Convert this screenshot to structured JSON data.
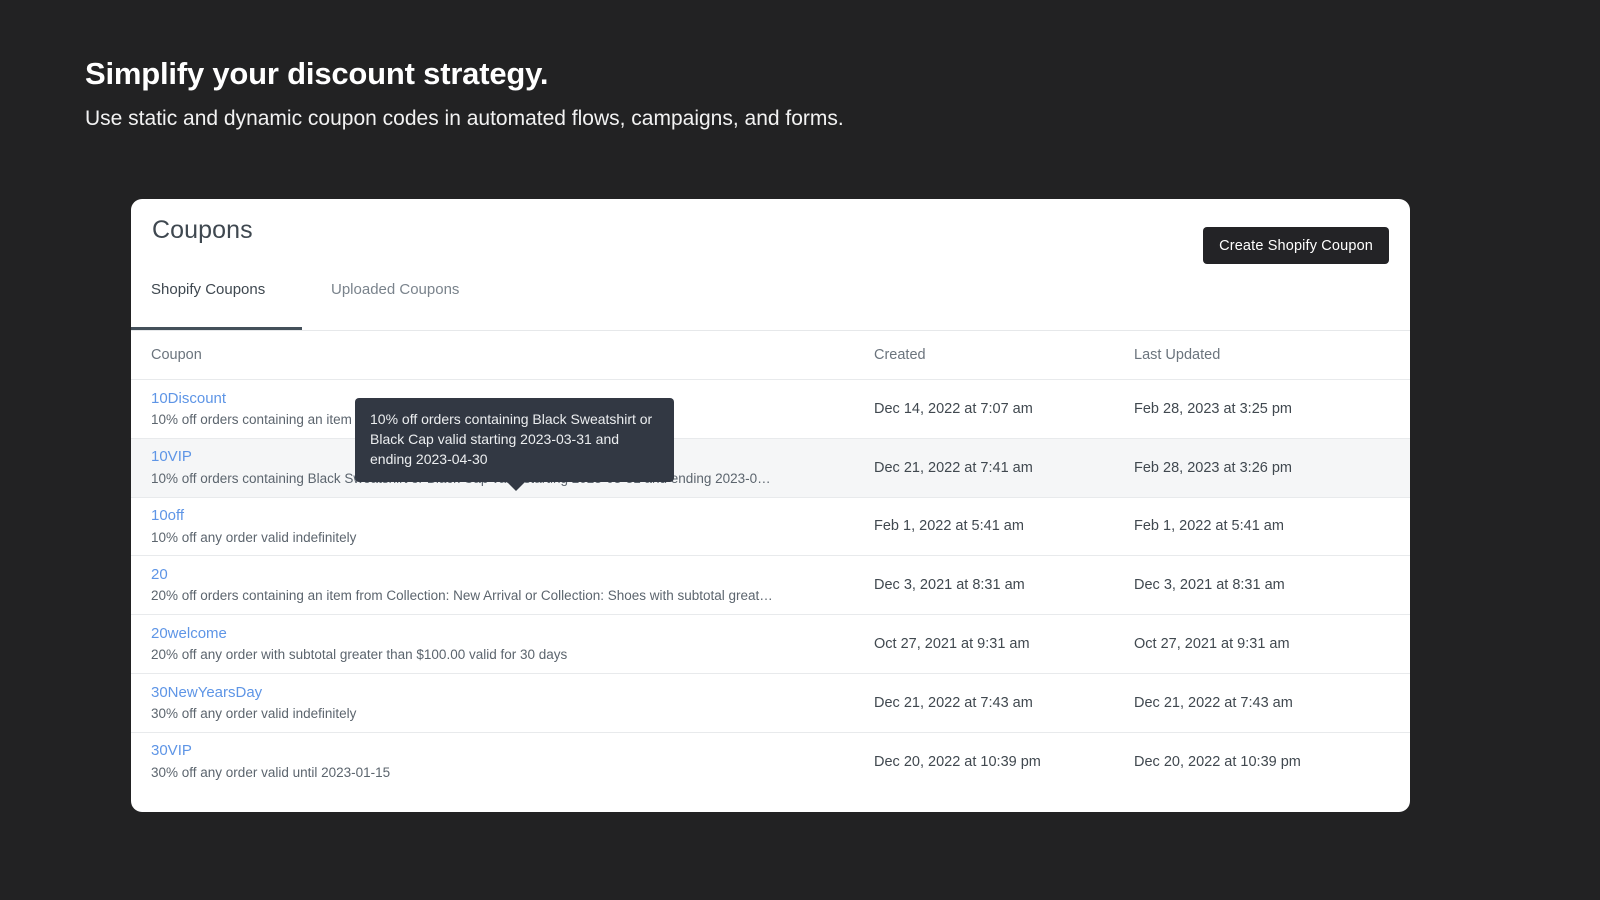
{
  "hero": {
    "title": "Simplify your discount strategy.",
    "subtitle": "Use static and dynamic coupon codes in automated flows, campaigns, and forms."
  },
  "card": {
    "title": "Coupons",
    "create_button_label": "Create Shopify Coupon",
    "tabs": [
      {
        "label": "Shopify Coupons",
        "active": true
      },
      {
        "label": "Uploaded Coupons",
        "active": false
      }
    ]
  },
  "table": {
    "columns": {
      "coupon": "Coupon",
      "created": "Created",
      "last_updated": "Last Updated"
    },
    "rows": [
      {
        "code": "10Discount",
        "description": "10% off orders containing an item from Collection: Under $100 valid i…",
        "created": "Dec 14, 2022 at 7:07 am",
        "last_updated": "Feb 28, 2023 at 3:25 pm",
        "hovered": false
      },
      {
        "code": "10VIP",
        "description": "10% off orders containing Black Sweatshirt or Black Cap valid starting 2023-03-31 and ending 2023-0…",
        "created": "Dec 21, 2022 at 7:41 am",
        "last_updated": "Feb 28, 2023 at 3:26 pm",
        "hovered": true
      },
      {
        "code": "10off",
        "description": "10% off any order valid indefinitely",
        "created": "Feb 1, 2022 at 5:41 am",
        "last_updated": "Feb 1, 2022 at 5:41 am",
        "hovered": false
      },
      {
        "code": "20",
        "description": "20% off orders containing an item from Collection: New Arrival or Collection: Shoes with subtotal great…",
        "created": "Dec 3, 2021 at 8:31 am",
        "last_updated": "Dec 3, 2021 at 8:31 am",
        "hovered": false
      },
      {
        "code": "20welcome",
        "description": "20% off any order with subtotal greater than $100.00 valid for 30 days",
        "created": "Oct 27, 2021 at 9:31 am",
        "last_updated": "Oct 27, 2021 at 9:31 am",
        "hovered": false
      },
      {
        "code": "30NewYearsDay",
        "description": "30% off any order valid indefinitely",
        "created": "Dec 21, 2022 at 7:43 am",
        "last_updated": "Dec 21, 2022 at 7:43 am",
        "hovered": false
      },
      {
        "code": "30VIP",
        "description": "30% off any order valid until 2023-01-15",
        "created": "Dec 20, 2022 at 10:39 pm",
        "last_updated": "Dec 20, 2022 at 10:39 pm",
        "hovered": false
      }
    ]
  },
  "tooltip": {
    "text": "10% off orders containing Black Sweatshirt or Black Cap valid starting 2023-03-31 and ending 2023-04-30"
  },
  "colors": {
    "page_background": "#222223",
    "card_background": "#ffffff",
    "link": "#5e95e6",
    "button_background": "#232326",
    "tooltip_background": "#323843",
    "row_hover": "#f5f6f7",
    "tab_active_underline": "#44505a"
  }
}
